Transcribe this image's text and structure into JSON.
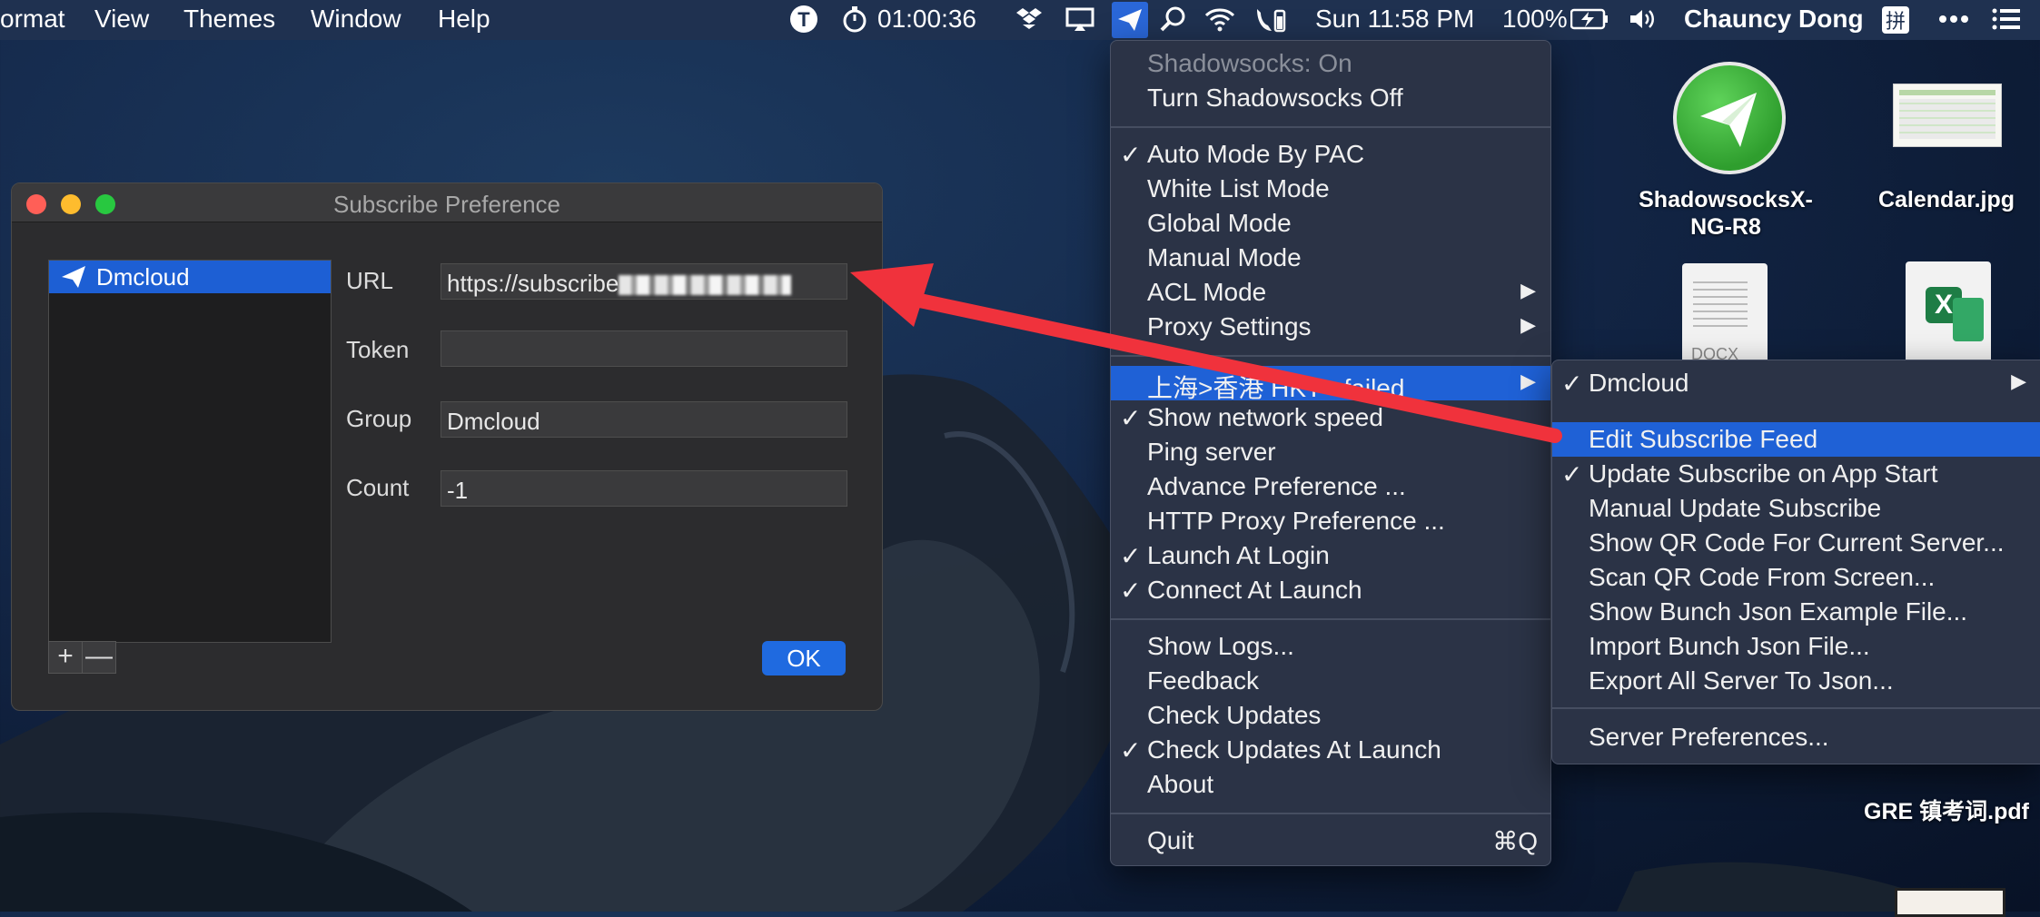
{
  "menubar": {
    "left_items": [
      "ormat",
      "View",
      "Themes",
      "Window",
      "Help"
    ],
    "timer": "01:00:36",
    "datetime": "Sun 11:58 PM",
    "battery": "100%",
    "user": "Chauncy Dong",
    "input_method": "拼"
  },
  "window": {
    "title": "Subscribe Preference",
    "list_items": [
      "Dmcloud"
    ],
    "fields": {
      "url_label": "URL",
      "url_value": "https://subscribe",
      "token_label": "Token",
      "token_value": "",
      "group_label": "Group",
      "group_value": "Dmcloud",
      "count_label": "Count",
      "count_value": "-1"
    },
    "add_label": "+",
    "remove_label": "—",
    "ok_label": "OK"
  },
  "main_menu": {
    "status": "Shadowsocks: On",
    "toggle": "Turn Shadowsocks Off",
    "modes": [
      {
        "label": "Auto Mode By PAC",
        "checked": true
      },
      {
        "label": "White List Mode",
        "checked": false
      },
      {
        "label": "Global Mode",
        "checked": false
      },
      {
        "label": "Manual Mode",
        "checked": false
      },
      {
        "label": "ACL Mode",
        "checked": false
      },
      {
        "label": "Proxy Settings",
        "checked": false
      }
    ],
    "server": "上海>香港 HKT - failed",
    "options": [
      {
        "label": "Show network speed",
        "checked": true
      },
      {
        "label": "Ping server",
        "checked": false
      },
      {
        "label": "Advance Preference ...",
        "checked": false
      },
      {
        "label": "HTTP Proxy Preference ...",
        "checked": false
      },
      {
        "label": "Launch At Login",
        "checked": true
      },
      {
        "label": "Connect At Launch",
        "checked": true
      }
    ],
    "misc": [
      {
        "label": "Show Logs...",
        "checked": false
      },
      {
        "label": "Feedback",
        "checked": false
      },
      {
        "label": "Check Updates",
        "checked": false
      },
      {
        "label": "Check Updates At Launch",
        "checked": true
      },
      {
        "label": "About",
        "checked": false
      }
    ],
    "quit": "Quit",
    "quit_shortcut": "⌘Q"
  },
  "submenu": {
    "group": "Dmcloud",
    "items": [
      {
        "label": "Edit Subscribe Feed",
        "checked": false
      },
      {
        "label": "Update Subscribe on App Start",
        "checked": true
      },
      {
        "label": "Manual Update Subscribe",
        "checked": false
      },
      {
        "label": "Show QR Code For Current Server...",
        "checked": false
      },
      {
        "label": "Scan QR Code From Screen...",
        "checked": false
      },
      {
        "label": "Show Bunch Json Example File...",
        "checked": false
      },
      {
        "label": "Import Bunch Json File...",
        "checked": false
      },
      {
        "label": "Export All Server To Json...",
        "checked": false
      }
    ],
    "server_prefs": "Server Preferences..."
  },
  "desktop": {
    "app_icon_label_1": "ShadowsocksX-",
    "app_icon_label_2": "NG-R8",
    "calendar_label": "Calendar.jpg",
    "pdf_label": "GRE 镇考词.pdf",
    "docx_badge": "DOCX"
  },
  "colors": {
    "accent": "#1f61d6",
    "arrow": "#f0323c",
    "menubar": "#1f3150"
  }
}
